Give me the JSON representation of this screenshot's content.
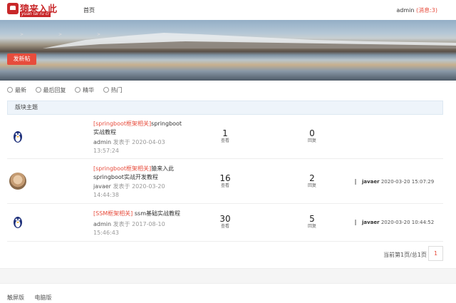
{
  "header": {
    "logo_title": "猿来入此",
    "logo_sub": "yuan lai ru ci",
    "nav_home": "首页",
    "user_name": "admin",
    "message_text": "(消息:3)"
  },
  "banner": {
    "crumbs": [
      ">",
      ">",
      ">"
    ],
    "post_button": "发新帖"
  },
  "tabs": [
    {
      "label": "最新",
      "icon": "clock-icon"
    },
    {
      "label": "最后回复",
      "icon": "chat-icon"
    },
    {
      "label": "精华",
      "icon": "star-icon"
    },
    {
      "label": "热门",
      "icon": "fire-icon"
    }
  ],
  "section": {
    "title": "版块主题"
  },
  "threads": [
    {
      "avatar": "penguin-avatar",
      "category": "[springboot框架相关]",
      "title": "springboot实战教程",
      "author": "admin",
      "posted_prefix": "发表于",
      "date": "2020-04-03",
      "time": "13:57:24",
      "views": "1",
      "views_label": "查看",
      "replies": "0",
      "replies_label": "回复",
      "last_user": "",
      "last_time": ""
    },
    {
      "avatar": "photo-avatar",
      "category": "[springboot框架相关]",
      "title": "猿来入此springboot实战开发教程",
      "author": "javaer",
      "posted_prefix": "发表于",
      "date": "2020-03-20",
      "time": "14:44:38",
      "views": "16",
      "views_label": "查看",
      "replies": "2",
      "replies_label": "回复",
      "last_user": "javaer",
      "last_time": "2020-03-20 15:07:29"
    },
    {
      "avatar": "penguin-avatar",
      "category": "[SSM框架相关]",
      "title": "ssm基础实战教程",
      "author": "admin",
      "posted_prefix": "发表于",
      "date": "2017-08-10",
      "time": "15:46:43",
      "views": "30",
      "views_label": "查看",
      "replies": "5",
      "replies_label": "回复",
      "last_user": "javaer",
      "last_time": "2020-03-20 10:44:52"
    }
  ],
  "pager": {
    "text": "当前第1页/总1页",
    "current": "1"
  },
  "footer": {
    "touch": "触屏版",
    "pc": "电脑版"
  },
  "colors": {
    "accent": "#e74c3c",
    "brand": "#c8282a"
  }
}
